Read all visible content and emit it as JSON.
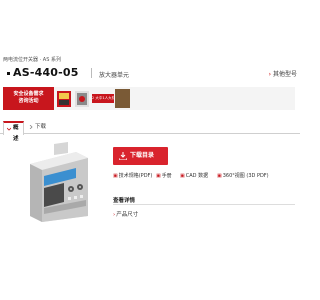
{
  "breadcrumb": "两电流位开关器 · AS 系列",
  "product": {
    "model": "AS-440-05",
    "subtitle": "放大器单元",
    "other_models": "其他型号"
  },
  "banner": {
    "line1": "安全设备需求",
    "line2": "咨询活动",
    "tag": "2 大中1人大礼赠"
  },
  "tabs": [
    {
      "label": "概述",
      "active": true
    },
    {
      "label": "下载",
      "active": false
    }
  ],
  "download_button": "下载目录",
  "downloads": [
    {
      "label": "技术规格(PDF)"
    },
    {
      "label": "手册"
    },
    {
      "label": "CAD 数据"
    },
    {
      "label": "360°视图 (3D PDF)"
    }
  ],
  "details": {
    "title": "查看详情",
    "spec_link": "产品尺寸"
  },
  "colors": {
    "accent": "#c8161d",
    "button": "#d9232d",
    "banner_bg": "#f4f4f4"
  }
}
